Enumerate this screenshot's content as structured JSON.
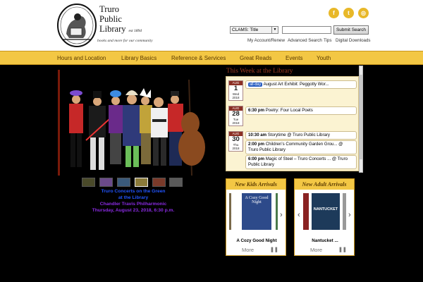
{
  "header": {
    "name_lines": [
      "Truro",
      "Public",
      "Library"
    ],
    "established": "est 1894",
    "tagline": "books and more for our community",
    "social": [
      {
        "icon": "facebook-icon",
        "glyph": "f"
      },
      {
        "icon": "twitter-icon",
        "glyph": "t"
      },
      {
        "icon": "instagram-icon",
        "glyph": "◎"
      }
    ]
  },
  "search": {
    "scope_selected": "CLAMS: Title",
    "query_value": "",
    "button_label": "Submit Search",
    "links": [
      "My Account/Renew",
      "Advanced Search",
      "Tips",
      "Digital Downloads"
    ]
  },
  "nav": {
    "items": [
      "Hours and Location",
      "Library Basics",
      "Reference & Services",
      "Great Reads",
      "Events",
      "Youth"
    ]
  },
  "slideshow": {
    "caption_lines": [
      "Truro Concerts on the Green",
      "at the Library",
      "Chandler Travis Philharmonic",
      "Thursday, August 23, 2018, 6:30 p.m."
    ],
    "caption_colors": [
      "#2255ff",
      "#2255ff",
      "#8a2be2",
      "#8a2be2"
    ]
  },
  "calendar": {
    "title": "This Week at the Library",
    "days": [
      {
        "month": "AUG",
        "day": "1",
        "weekday": "Wed",
        "year": "2018",
        "events": [
          {
            "badge": "all-day",
            "time": "",
            "lines": [
              "August Art Exhibit: Peggotty Wor..."
            ]
          }
        ]
      },
      {
        "month": "AUG",
        "day": "28",
        "weekday": "Tue",
        "year": "2018",
        "events": [
          {
            "badge": "",
            "time": "6:30 pm",
            "lines": [
              "Poetry: Four Local Poets"
            ]
          }
        ]
      },
      {
        "month": "AUG",
        "day": "30",
        "weekday": "Thu",
        "year": "2018",
        "events": [
          {
            "badge": "",
            "time": "10:30 am",
            "lines": [
              "Storytime @ Truro Public Library"
            ]
          },
          {
            "badge": "",
            "time": "2:00 pm",
            "lines": [
              "Children's Community Garden Grou... @",
              "Truro Public Library"
            ]
          },
          {
            "badge": "",
            "time": "6:00 pm",
            "lines": [
              "Magic of Steel – Truro Concerts ... @ Truro",
              "Public Library"
            ]
          }
        ]
      }
    ]
  },
  "kids": {
    "title": "New Kids Arrivals",
    "book_title": "A Cozy Good Night",
    "cover_text": "A Cozy Good Night",
    "more_label": "More",
    "pause_icon": "pause-icon"
  },
  "adults": {
    "title": "New Adult Arrivals",
    "book_title": "Nantucket ...",
    "cover_text": "NANTUCKET",
    "more_label": "More",
    "pause_icon": "pause-icon"
  },
  "colors": {
    "nav_bg": "#f3c744",
    "accent_red": "#8b2f24",
    "calendar_bg": "#fbf3d2"
  }
}
